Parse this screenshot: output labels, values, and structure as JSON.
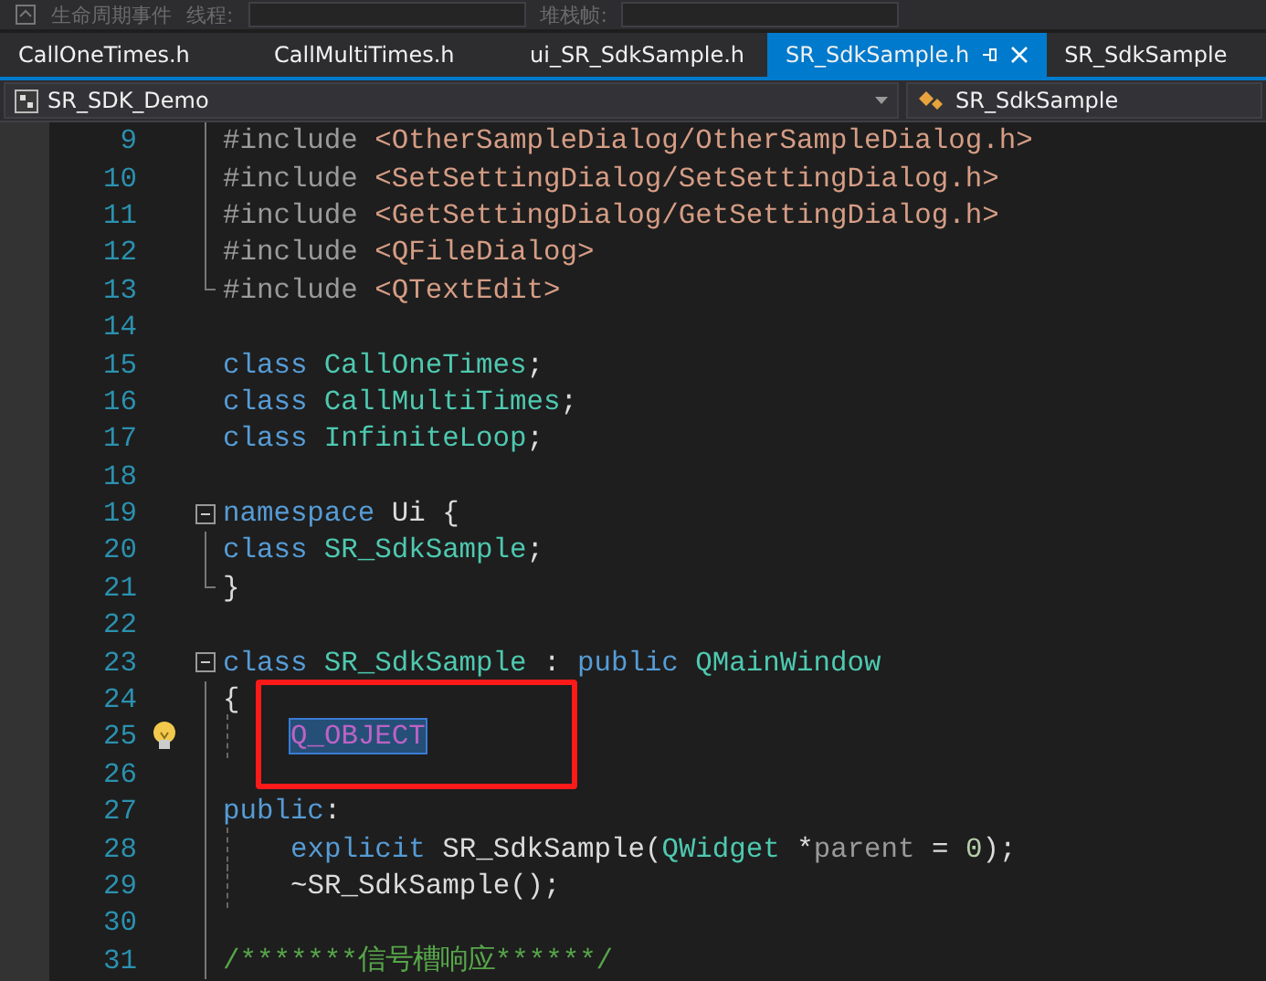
{
  "toolbar": {
    "items": [
      {
        "kind": "label",
        "text": "生命周期事件"
      },
      {
        "kind": "label",
        "text": "线程:"
      },
      {
        "kind": "field"
      },
      {
        "kind": "label",
        "text": "堆栈帧:"
      },
      {
        "kind": "field"
      }
    ]
  },
  "tabs": [
    {
      "label": "CallOneTimes.h",
      "selected": false
    },
    {
      "label": "CallMultiTimes.h",
      "selected": false
    },
    {
      "label": "ui_SR_SdkSample.h",
      "selected": false
    },
    {
      "label": "SR_SdkSample.h",
      "selected": true
    },
    {
      "label": "SR_SdkSample",
      "selected": false
    }
  ],
  "nav": {
    "project": "SR_SDK_Demo",
    "scope": "SR_SdkSample"
  },
  "lines": [
    {
      "number": "9",
      "in_fold": true,
      "tokens": [
        {
          "kind": "pp",
          "text": "#include "
        },
        {
          "kind": "str",
          "text": "<OtherSampleDialog/OtherSampleDialog.h>"
        }
      ]
    },
    {
      "number": "10",
      "in_fold": true,
      "tokens": [
        {
          "kind": "pp",
          "text": "#include "
        },
        {
          "kind": "str",
          "text": "<SetSettingDialog/SetSettingDialog.h>"
        }
      ]
    },
    {
      "number": "11",
      "in_fold": true,
      "tokens": [
        {
          "kind": "pp",
          "text": "#include "
        },
        {
          "kind": "str",
          "text": "<GetSettingDialog/GetSettingDialog.h>"
        }
      ]
    },
    {
      "number": "12",
      "in_fold": true,
      "tokens": [
        {
          "kind": "pp",
          "text": "#include "
        },
        {
          "kind": "str",
          "text": "<QFileDialog>"
        }
      ]
    },
    {
      "number": "13",
      "fold_end": true,
      "tokens": [
        {
          "kind": "pp",
          "text": "#include "
        },
        {
          "kind": "str",
          "text": "<QTextEdit>"
        }
      ]
    },
    {
      "number": "14"
    },
    {
      "number": "15",
      "tokens": [
        {
          "kind": "kw",
          "text": "class "
        },
        {
          "kind": "type",
          "text": "CallOneTimes"
        },
        {
          "kind": "plain",
          "text": ";"
        }
      ]
    },
    {
      "number": "16",
      "tokens": [
        {
          "kind": "kw",
          "text": "class "
        },
        {
          "kind": "type",
          "text": "CallMultiTimes"
        },
        {
          "kind": "plain",
          "text": ";"
        }
      ]
    },
    {
      "number": "17",
      "tokens": [
        {
          "kind": "kw",
          "text": "class "
        },
        {
          "kind": "type",
          "text": "InfiniteLoop"
        },
        {
          "kind": "plain",
          "text": ";"
        }
      ]
    },
    {
      "number": "18"
    },
    {
      "number": "19",
      "fold_start": true,
      "tokens": [
        {
          "kind": "kw",
          "text": "namespace "
        },
        {
          "kind": "plain",
          "text": "Ui {"
        }
      ]
    },
    {
      "number": "20",
      "in_fold": true,
      "tokens": [
        {
          "kind": "kw",
          "text": "class "
        },
        {
          "kind": "type",
          "text": "SR_SdkSample"
        },
        {
          "kind": "plain",
          "text": ";"
        }
      ]
    },
    {
      "number": "21",
      "fold_end": true,
      "tokens": [
        {
          "kind": "plain",
          "text": "}"
        }
      ]
    },
    {
      "number": "22"
    },
    {
      "number": "23",
      "fold_start": true,
      "tokens": [
        {
          "kind": "kw",
          "text": "class "
        },
        {
          "kind": "type",
          "text": "SR_SdkSample "
        },
        {
          "kind": "plain",
          "text": ": "
        },
        {
          "kind": "kw",
          "text": "public "
        },
        {
          "kind": "type",
          "text": "QMainWindow"
        }
      ]
    },
    {
      "number": "24",
      "in_fold": true,
      "tokens": [
        {
          "kind": "plain",
          "text": "{"
        }
      ]
    },
    {
      "number": "25",
      "in_fold": true,
      "lightbulb": true,
      "annotated": true,
      "indented": true,
      "tokens": [
        {
          "kind": "macro",
          "text": "Q_OBJECT",
          "selected": true
        }
      ]
    },
    {
      "number": "26",
      "in_fold": true
    },
    {
      "number": "27",
      "in_fold": true,
      "tokens": [
        {
          "kind": "kw",
          "text": "public"
        },
        {
          "kind": "plain",
          "text": ":"
        }
      ]
    },
    {
      "number": "28",
      "in_fold": true,
      "indented": true,
      "tokens": [
        {
          "kind": "kw",
          "text": "explicit "
        },
        {
          "kind": "plain",
          "text": "SR_SdkSample("
        },
        {
          "kind": "type",
          "text": "QWidget "
        },
        {
          "kind": "plain",
          "text": "*"
        },
        {
          "kind": "param",
          "text": "parent "
        },
        {
          "kind": "plain",
          "text": "= "
        },
        {
          "kind": "num",
          "text": "0"
        },
        {
          "kind": "plain",
          "text": ");"
        }
      ]
    },
    {
      "number": "29",
      "in_fold": true,
      "indented": true,
      "tokens": [
        {
          "kind": "plain",
          "text": "~SR_SdkSample();"
        }
      ]
    },
    {
      "number": "30",
      "in_fold": true
    },
    {
      "number": "31",
      "in_fold": true,
      "tokens": [
        {
          "kind": "comment",
          "text": "/*******信号槽响应******/"
        }
      ]
    }
  ]
}
